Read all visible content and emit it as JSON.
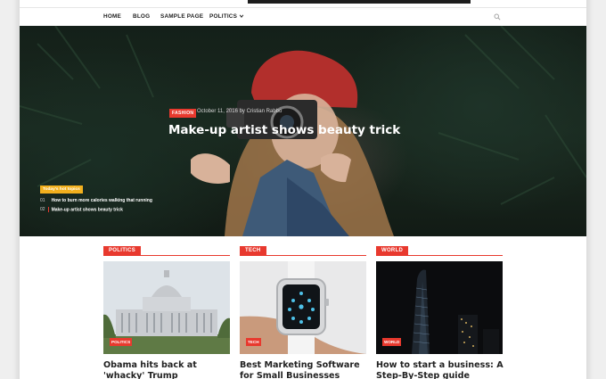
{
  "nav": {
    "items": [
      "HOME",
      "BLOG",
      "SAMPLE PAGE",
      "POLITICS"
    ],
    "dropdown_icon": "chevron-down-icon",
    "search_icon": "search-icon"
  },
  "hero": {
    "category": "FASHION",
    "meta": "October 11, 2016  by  Cristian Rabbo",
    "title": "Make-up artist shows beauty trick",
    "hot_topics_label": "Today's hot topics",
    "hot_topics": [
      {
        "num": "01",
        "title": "How to burn more calories walking that running"
      },
      {
        "num": "02",
        "title": "Make-up artist shows beauty trick"
      }
    ]
  },
  "cards": [
    {
      "category": "POLITICS",
      "badge": "POLITICS",
      "title": "Obama hits back at 'whacky' Trump"
    },
    {
      "category": "TECH",
      "badge": "TECH",
      "title": "Best Marketing Software for Small Businesses"
    },
    {
      "category": "WORLD",
      "badge": "WORLD",
      "title": "How to start a business: A Step-By-Step guide"
    }
  ],
  "colors": {
    "accent": "#e8392e",
    "hot_badge": "#f2b01e",
    "text": "#222222"
  }
}
